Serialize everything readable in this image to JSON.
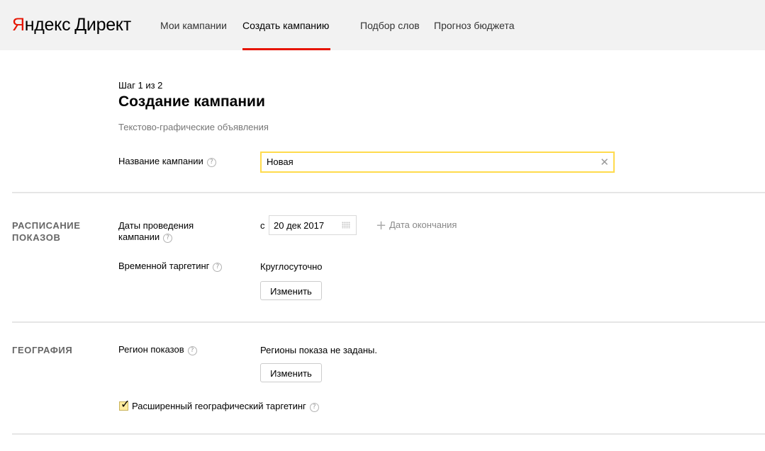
{
  "header": {
    "logo_brand": "Яндекс",
    "logo_product": "Директ",
    "nav": [
      {
        "label": "Мои кампании"
      },
      {
        "label": "Создать кампанию"
      },
      {
        "label": "Подбор слов"
      },
      {
        "label": "Прогноз бюджета"
      }
    ],
    "active_nav": "Создать кампанию",
    "accent_color": "#e61400"
  },
  "page": {
    "step": "Шаг 1 из 2",
    "title": "Создание кампании",
    "subtitle": "Текстово-графические объявления"
  },
  "campaign_name": {
    "label": "Название кампании",
    "value": "Новая",
    "clear_icon": "close-icon"
  },
  "schedule": {
    "section_line1": "РАСПИСАНИЕ",
    "section_line2": "ПОКАЗОВ",
    "dates_label_line1": "Даты проведения",
    "dates_label_line2": "кампании",
    "from_prefix": "с",
    "start_date": "20 дек 2017",
    "add_end_date": "Дата окончания",
    "time_targeting_label": "Временной таргетинг",
    "time_targeting_value": "Круглосуточно",
    "change_button": "Изменить"
  },
  "geography": {
    "section_title": "ГЕОГРАФИЯ",
    "region_label": "Регион показов",
    "region_value": "Регионы показа не заданы.",
    "change_button": "Изменить",
    "extended_targeting_label": "Расширенный географический таргетинг",
    "extended_targeting_checked": true
  },
  "help_icon": "?"
}
